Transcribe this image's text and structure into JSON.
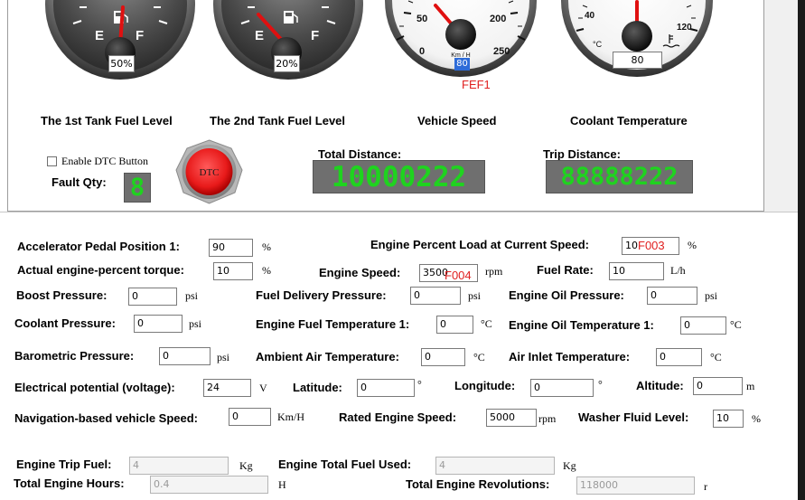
{
  "gauges": {
    "tank1": {
      "label": "The 1st Tank Fuel Level",
      "empty_mark": "E",
      "full_mark": "F",
      "value": "50%"
    },
    "tank2": {
      "label": "The 2nd Tank Fuel Level",
      "empty_mark": "E",
      "full_mark": "F",
      "value": "20%"
    },
    "speed": {
      "label": "Vehicle Speed",
      "tick_0": "0",
      "tick_50": "50",
      "tick_200": "200",
      "tick_250": "250",
      "unit": "Km / H",
      "value": "80",
      "tag": "FEF1"
    },
    "coolant": {
      "label": "Coolant Temperature",
      "tick_40": "40",
      "tick_120": "120",
      "unit": "°C",
      "value": "80"
    }
  },
  "dtc": {
    "enable_label": "Enable DTC Button",
    "fault_qty_label": "Fault Qty:",
    "fault_qty_value": "8",
    "button_label": "DTC"
  },
  "distance": {
    "total_label": "Total Distance:",
    "total_value": "10000222",
    "trip_label": "Trip Distance:",
    "trip_value": "88888222"
  },
  "fields": {
    "accel": {
      "label": "Accelerator Pedal Position 1:",
      "value": "90",
      "unit": "%"
    },
    "load": {
      "label": "Engine Percent Load at Current Speed:",
      "value": "10",
      "unit": "%",
      "tag": "F003"
    },
    "torque": {
      "label": "Actual engine-percent torque:",
      "value": "10",
      "unit": "%"
    },
    "speed": {
      "label": "Engine Speed:",
      "value": "3500",
      "unit": "rpm",
      "tag": "F004"
    },
    "fuel_rate": {
      "label": "Fuel Rate:",
      "value": "10",
      "unit": "L/h"
    },
    "boost": {
      "label": "Boost Pressure:",
      "value": "0",
      "unit": "psi"
    },
    "fuel_delivery": {
      "label": "Fuel Delivery Pressure:",
      "value": "0",
      "unit": "psi"
    },
    "oil_pressure": {
      "label": "Engine Oil Pressure:",
      "value": "0",
      "unit": "psi"
    },
    "coolant_pressure": {
      "label": "Coolant Pressure:",
      "value": "0",
      "unit": "psi"
    },
    "fuel_temp": {
      "label": "Engine Fuel Temperature 1:",
      "value": "0",
      "unit": "°C"
    },
    "oil_temp": {
      "label": "Engine Oil Temperature 1:",
      "value": "0",
      "unit": "°C"
    },
    "barometric": {
      "label": "Barometric Pressure:",
      "value": "0",
      "unit": "psi"
    },
    "ambient": {
      "label": "Ambient Air Temperature:",
      "value": "0",
      "unit": "°C"
    },
    "air_inlet": {
      "label": "Air Inlet Temperature:",
      "value": "0",
      "unit": "°C"
    },
    "voltage": {
      "label": "Electrical potential (voltage):",
      "value": "24",
      "unit": "V"
    },
    "latitude": {
      "label": "Latitude:",
      "value": "0",
      "unit": "°"
    },
    "longitude": {
      "label": "Longitude:",
      "value": "0",
      "unit": "°"
    },
    "altitude": {
      "label": "Altitude:",
      "value": "0",
      "unit": "m"
    },
    "nav_speed": {
      "label": "Navigation-based vehicle Speed:",
      "value": "0",
      "unit": "Km/H"
    },
    "rated_speed": {
      "label": "Rated Engine Speed:",
      "value": "5000",
      "unit": "rpm"
    },
    "washer": {
      "label": "Washer Fluid Level:",
      "value": "10",
      "unit": "%"
    },
    "trip_fuel": {
      "label": "Engine Trip Fuel:",
      "value": "4",
      "unit": "Kg"
    },
    "total_fuel": {
      "label": "Engine Total Fuel Used:",
      "value": "4",
      "unit": "Kg"
    },
    "engine_hours": {
      "label": "Total Engine Hours:",
      "value": "0.4",
      "unit": "H"
    },
    "revolutions": {
      "label": "Total Engine Revolutions:",
      "value": "118000",
      "unit": "r"
    }
  },
  "colors": {
    "digit_green": "#1fd31f",
    "display_bg": "#6f6f6f",
    "tag_red": "#e02020",
    "needle_red": "#e01010"
  }
}
